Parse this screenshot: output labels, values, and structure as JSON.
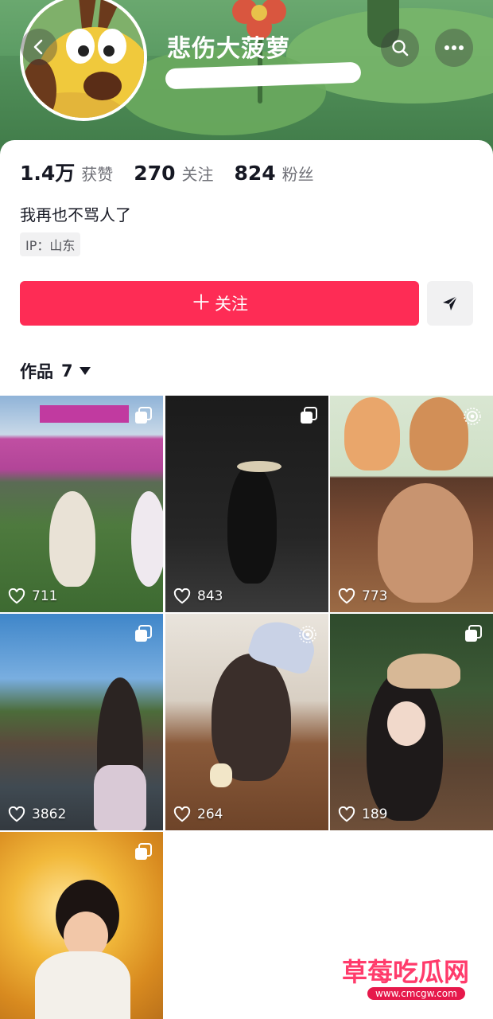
{
  "profile": {
    "nickname": "悲伤大菠萝",
    "bio": "我再也不骂人了",
    "ip_location": "IP：山东"
  },
  "stats": {
    "likes_value": "1.4万",
    "likes_label": "获赞",
    "following_value": "270",
    "following_label": "关注",
    "followers_value": "824",
    "followers_label": "粉丝"
  },
  "actions": {
    "follow_label": "关注",
    "follow_plus": "＋"
  },
  "tabs": {
    "works_label": "作品",
    "works_count": "7"
  },
  "colors": {
    "accent": "#fe2c55",
    "banner": "#4d8a55"
  },
  "works": [
    {
      "likes": "711",
      "badge": "multi-image-icon"
    },
    {
      "likes": "843",
      "badge": "multi-image-icon"
    },
    {
      "likes": "773",
      "badge": "live-photo-icon"
    },
    {
      "likes": "3862",
      "badge": "multi-image-icon"
    },
    {
      "likes": "264",
      "badge": "live-photo-icon"
    },
    {
      "likes": "189",
      "badge": "multi-image-icon"
    },
    {
      "likes": "",
      "badge": "multi-image-icon"
    }
  ],
  "watermark": {
    "title": "草莓吃瓜网",
    "url": "www.cmcgw.com"
  }
}
